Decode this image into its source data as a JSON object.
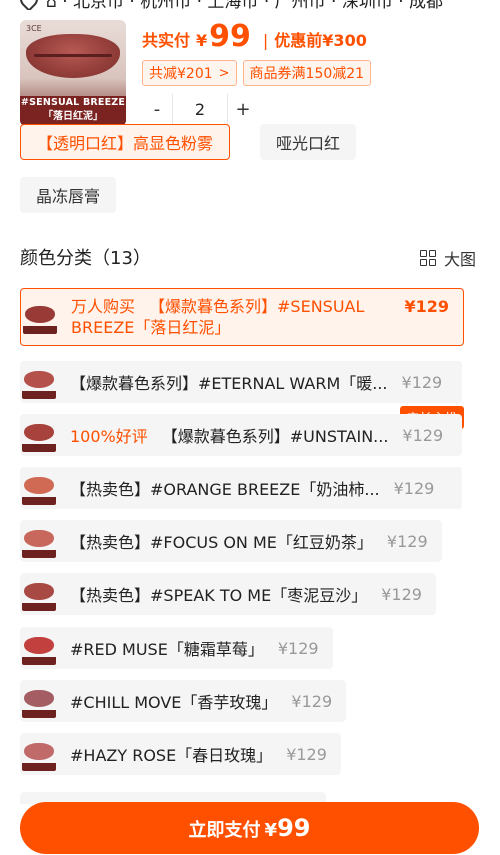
{
  "top": {
    "location_text": "⌂ · 北京市 · 杭州市 · 上海市 · 广州市 · 深圳市 · 成都"
  },
  "product": {
    "thumb_line1": "#SENSUAL BREEZE",
    "thumb_line2": "「落日红泥」",
    "thumb_brand": "3CE",
    "price_label": "共实付",
    "price_currency": "¥",
    "price_value": "99",
    "price_sep": "|",
    "original_price": "优惠前¥300",
    "discount_chip": "共减¥201",
    "coupon_chip": "商品券满150减21",
    "quantity": "2",
    "minus": "-",
    "plus": "+"
  },
  "varieties": [
    {
      "label": "【透明口红】高显色粉雾",
      "selected": true
    },
    {
      "label": "哑光口红",
      "selected": false
    },
    {
      "label": "晶冻唇膏",
      "selected": false
    }
  ],
  "colors": {
    "title": "颜色分类（13）",
    "view_label": "大图",
    "badge": "店长主推",
    "options": [
      {
        "prefix": "万人购买",
        "name": "【爆款暮色系列】#SENSUAL BREEZE「落日红泥」",
        "price": "¥129",
        "selected": true,
        "lip": "#9a3a36"
      },
      {
        "prefix": "",
        "name": "【爆款暮色系列】#ETERNAL WARM「暖...",
        "price": "¥129",
        "selected": false,
        "lip": "#b4514a"
      },
      {
        "prefix": "100%好评",
        "name": "【爆款暮色系列】#UNSTAIN...",
        "price": "¥129",
        "selected": false,
        "lip": "#a8423c"
      },
      {
        "prefix": "",
        "name": "【热卖色】#ORANGE BREEZE「奶油柿...",
        "price": "¥129",
        "selected": false,
        "lip": "#d06a55"
      },
      {
        "prefix": "",
        "name": "【热卖色】#FOCUS ON ME「红豆奶茶」",
        "price": "¥129",
        "selected": false,
        "lip": "#c8675c"
      },
      {
        "prefix": "",
        "name": "【热卖色】#SPEAK TO ME「枣泥豆沙」",
        "price": "¥129",
        "selected": false,
        "lip": "#a84a43"
      },
      {
        "prefix": "",
        "name": "#RED MUSE「糖霜草莓」",
        "price": "¥129",
        "selected": false,
        "lip": "#c2403d"
      },
      {
        "prefix": "",
        "name": "#CHILL MOVE「香芋玫瑰」",
        "price": "¥129",
        "selected": false,
        "lip": "#a45d63"
      },
      {
        "prefix": "",
        "name": "#HAZY ROSE「春日玫瑰」",
        "price": "¥129",
        "selected": false,
        "lip": "#c06a6a"
      }
    ]
  },
  "footer": {
    "pay_label": "立即支付",
    "pay_currency": "¥",
    "pay_amount": "99"
  },
  "colors_theme": {
    "accent": "#ff5000",
    "chip_bg": "#f5f5f5"
  }
}
